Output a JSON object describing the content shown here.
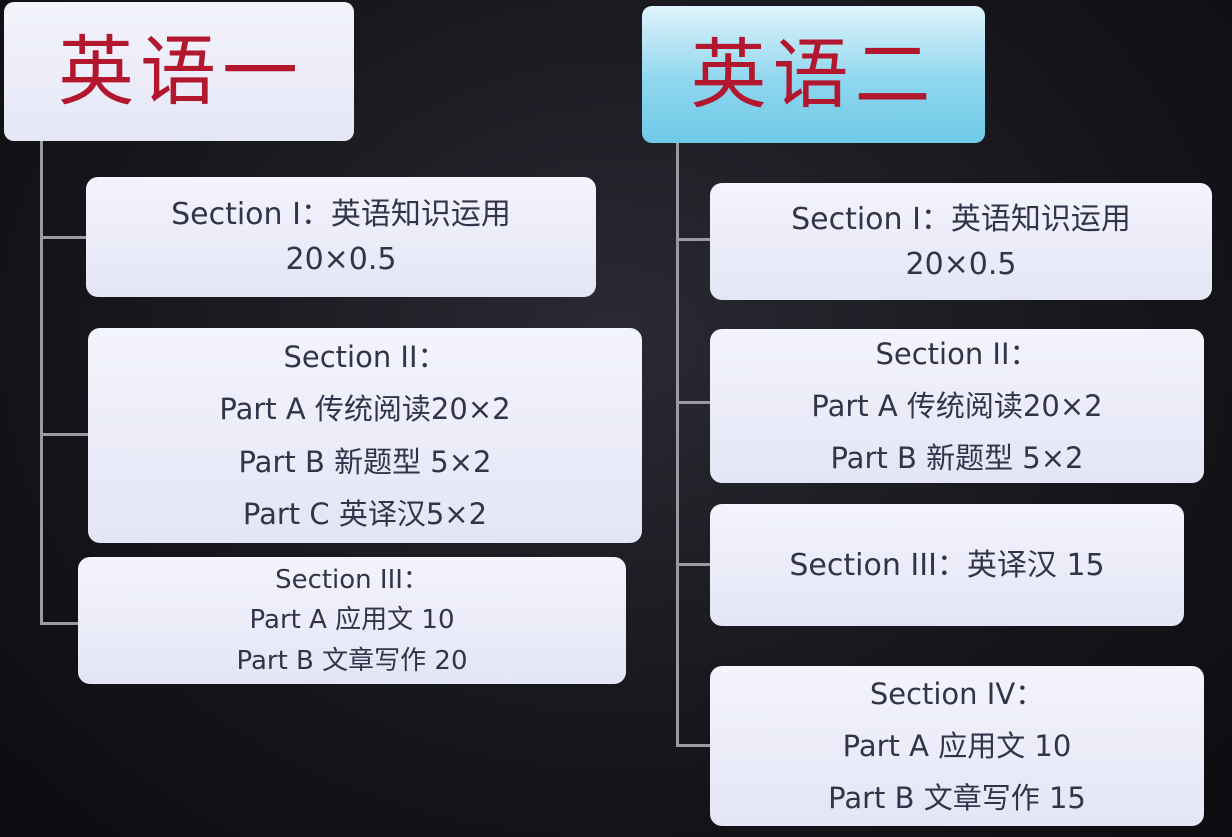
{
  "colors": {
    "title_text": "#b3172e",
    "connector": "#9a9aa2",
    "box_text": "#33334a"
  },
  "left": {
    "title": "英语一",
    "boxes": [
      {
        "lines": [
          "Section I：英语知识运用",
          "20×0.5"
        ]
      },
      {
        "lines": [
          "Section II：",
          "Part A 传统阅读20×2",
          "Part B 新题型 5×2",
          "Part C 英译汉5×2"
        ]
      },
      {
        "lines": [
          "Section III：",
          "Part A 应用文 10",
          "Part B 文章写作 20"
        ]
      }
    ]
  },
  "right": {
    "title": "英语二",
    "boxes": [
      {
        "lines": [
          "Section I：英语知识运用",
          "20×0.5"
        ]
      },
      {
        "lines": [
          "Section II：",
          "Part A 传统阅读20×2",
          "Part B 新题型 5×2"
        ]
      },
      {
        "lines": [
          "Section III：英译汉 15"
        ]
      },
      {
        "lines": [
          "Section IV：",
          "Part A 应用文 10",
          "Part B 文章写作 15"
        ]
      }
    ]
  }
}
